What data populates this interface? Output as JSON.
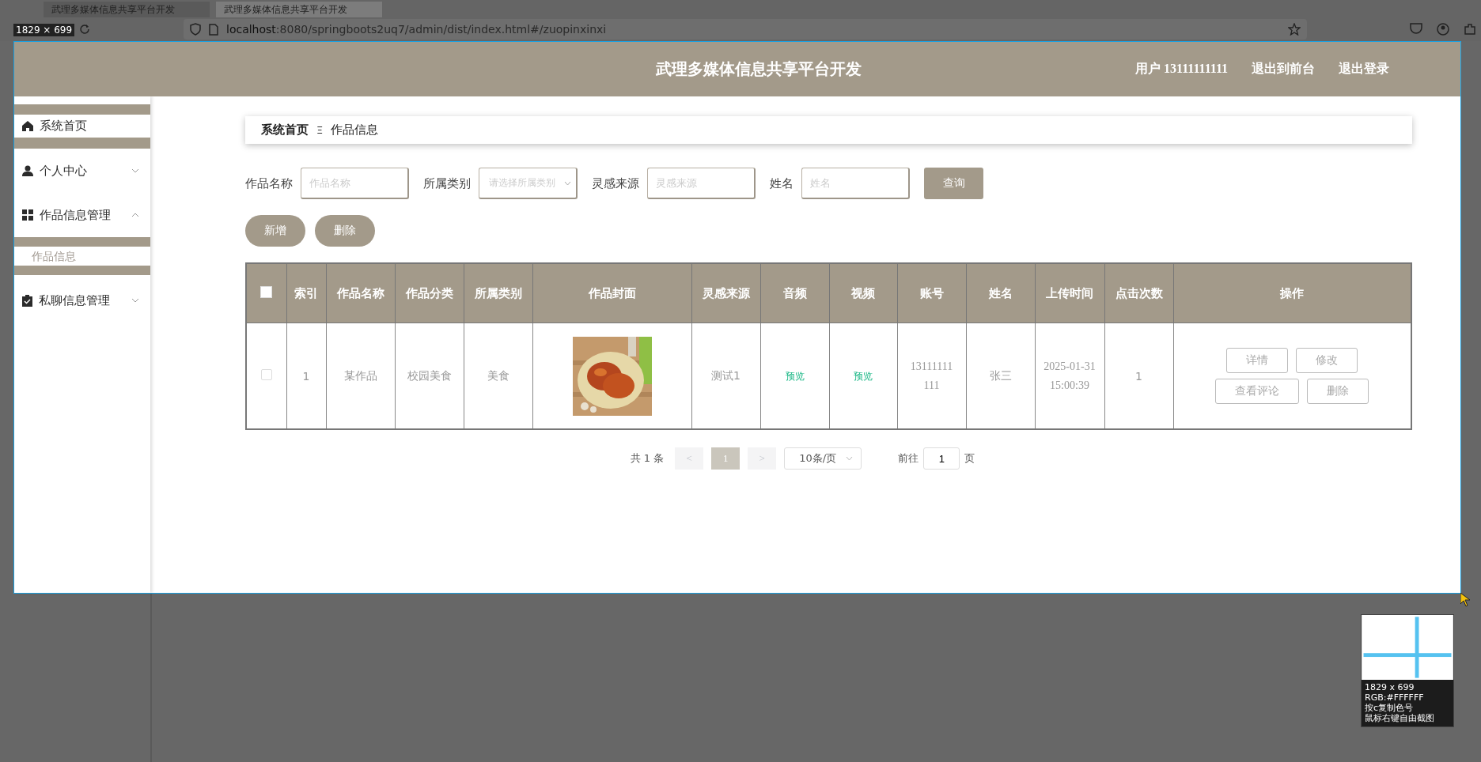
{
  "browser": {
    "tabs": [
      {
        "title": "武理多媒体信息共享平台开发",
        "selected": false
      },
      {
        "title": "武理多媒体信息共享平台开发",
        "selected": true
      }
    ],
    "address": {
      "host": "localhost",
      "path": ":8080/springboots2uq7/admin/dist/index.html#/zuopinxinxi"
    }
  },
  "capture": {
    "size_label": "1829 × 699",
    "magnifier": {
      "size": "1829 x 699",
      "rgb": "RGB:#FFFFFF",
      "hint_copy": "按c复制色号",
      "hint_crop": "鼠标右键自由截图"
    }
  },
  "header": {
    "title": "武理多媒体信息共享平台开发",
    "user": "用户 13111111111",
    "links": [
      "退出到前台",
      "退出登录"
    ]
  },
  "sidebar": {
    "items": [
      {
        "label": "系统首页",
        "selected": true
      },
      {
        "label": "个人中心",
        "expanded": false,
        "selected": false
      },
      {
        "label": "作品信息管理",
        "expanded": true,
        "selected": false,
        "children": [
          {
            "label": "作品信息",
            "selected": true
          }
        ]
      },
      {
        "label": "私聊信息管理",
        "expanded": false,
        "selected": false
      }
    ]
  },
  "breadcrumb": {
    "home": "系统首页",
    "separator": "Ξ",
    "current": "作品信息"
  },
  "filters": [
    {
      "kind": "input",
      "label": "作品名称",
      "placeholder": "作品名称"
    },
    {
      "kind": "select",
      "label": "所属类别",
      "placeholder": "请选择所属类别"
    },
    {
      "kind": "input",
      "label": "灵感来源",
      "placeholder": "灵感来源"
    },
    {
      "kind": "input",
      "label": "姓名",
      "placeholder": "姓名"
    }
  ],
  "search_button": "查询",
  "actions": [
    "新增",
    "删除"
  ],
  "table": {
    "select_all_checked": false,
    "columns": [
      "索引",
      "作品名称",
      "作品分类",
      "所属类别",
      "作品封面",
      "灵感来源",
      "音频",
      "视频",
      "账号",
      "姓名",
      "上传时间",
      "点击次数",
      "操作"
    ],
    "rows": [
      {
        "checked": false,
        "index": "1",
        "name": "某作品",
        "category": "校园美食",
        "type": "美食",
        "source": "测试1",
        "audio": "预览",
        "video": "预览",
        "account": "13111111111",
        "person": "张三",
        "uploaded": "2025-01-31 15:00:39",
        "clicks": "1",
        "operations": [
          "详情",
          "修改",
          "查看评论",
          "删除"
        ]
      }
    ]
  },
  "pagination": {
    "total": "共 1 条",
    "prev": "<",
    "pages": [
      {
        "label": "1",
        "selected": true
      }
    ],
    "next": ">",
    "page_size": "10条/页",
    "goto_label": "前往",
    "goto_value": "1",
    "goto_suffix": "页"
  }
}
